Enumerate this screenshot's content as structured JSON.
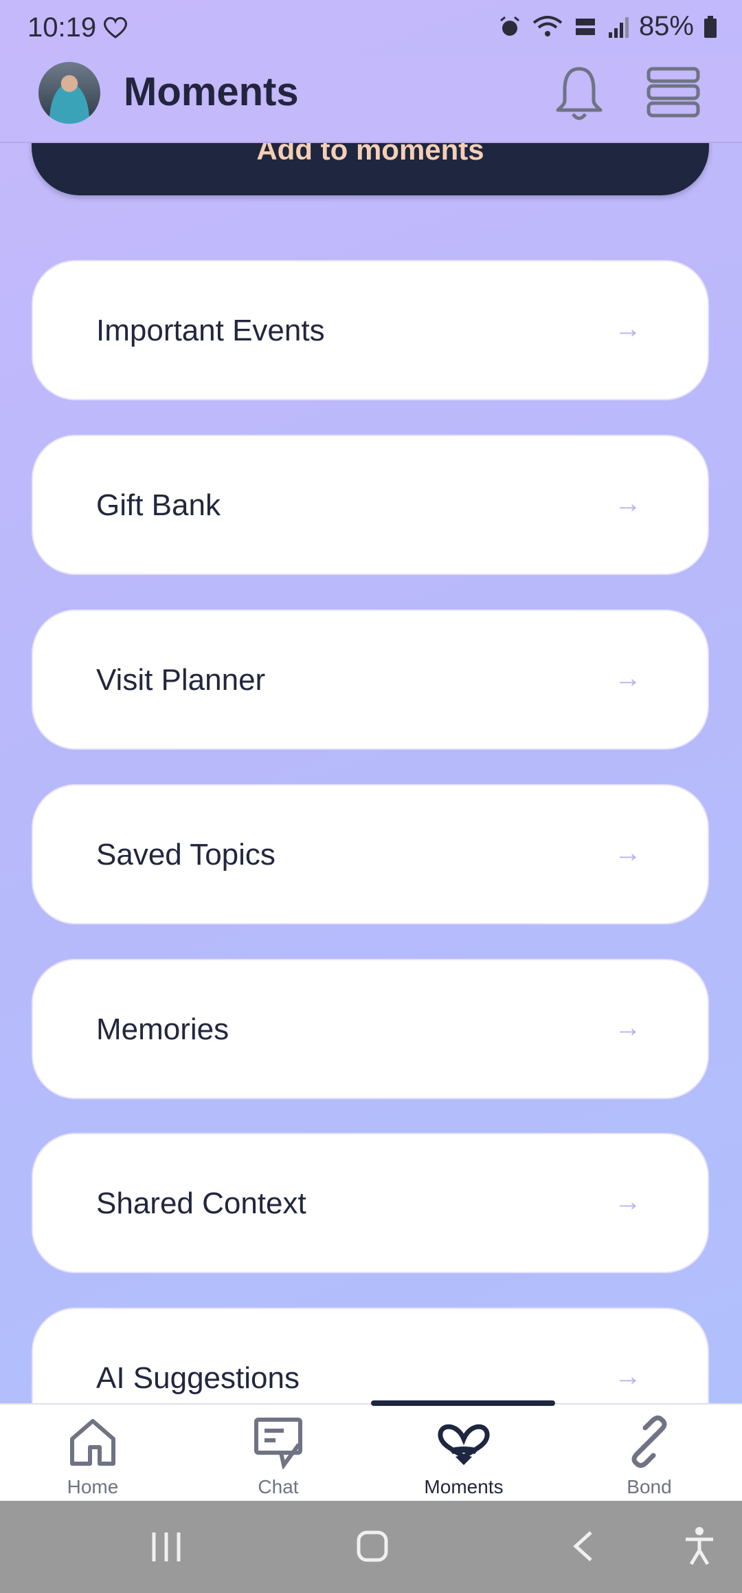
{
  "status_bar": {
    "time": "10:19",
    "battery": "85%"
  },
  "header": {
    "title": "Moments"
  },
  "add_button": {
    "label": "Add to moments"
  },
  "cards": [
    {
      "label": "Important Events",
      "arrow": "→"
    },
    {
      "label": "Gift Bank",
      "arrow": "→"
    },
    {
      "label": "Visit Planner",
      "arrow": "→"
    },
    {
      "label": "Saved Topics",
      "arrow": "→"
    },
    {
      "label": "Memories",
      "arrow": "→"
    },
    {
      "label": "Shared Context",
      "arrow": "→"
    },
    {
      "label": "AI Suggestions",
      "arrow": "→"
    }
  ],
  "bottom_nav": [
    {
      "label": "Home",
      "icon": "home-icon"
    },
    {
      "label": "Chat",
      "icon": "chat-icon"
    },
    {
      "label": "Moments",
      "icon": "heart-icon",
      "active": true
    },
    {
      "label": "Bond",
      "icon": "link-icon"
    }
  ],
  "colors": {
    "accent_dark": "#1e2640",
    "button_text": "#f5cfb5",
    "arrow": "#b9aef6"
  }
}
